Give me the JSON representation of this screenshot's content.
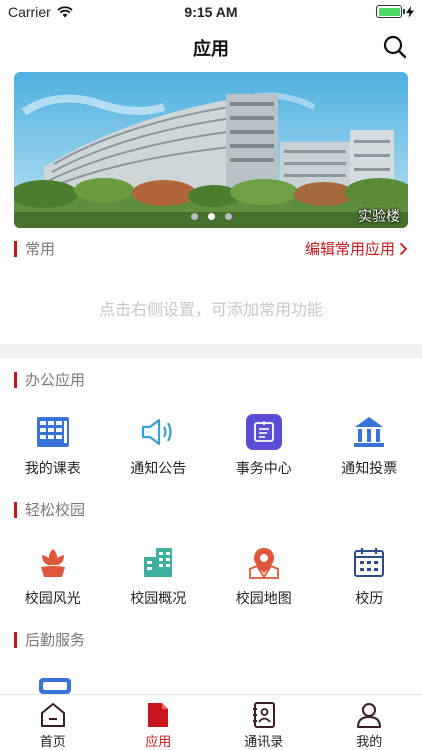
{
  "status_bar": {
    "carrier": "Carrier",
    "time": "9:15 AM",
    "battery_level": 1.0
  },
  "nav": {
    "title": "应用"
  },
  "banner": {
    "caption": "实验楼",
    "page_count": 3,
    "active_page": 2
  },
  "common": {
    "title": "常用",
    "edit_label": "编辑常用应用",
    "empty_hint": "点击右侧设置，可添加常用功能"
  },
  "sections": [
    {
      "title": "办公应用",
      "apps": [
        {
          "label": "我的课表",
          "icon": "timetable-icon"
        },
        {
          "label": "通知公告",
          "icon": "speaker-icon"
        },
        {
          "label": "事务中心",
          "icon": "affairs-icon"
        },
        {
          "label": "通知投票",
          "icon": "vote-icon"
        }
      ]
    },
    {
      "title": "轻松校园",
      "apps": [
        {
          "label": "校园风光",
          "icon": "flower-icon"
        },
        {
          "label": "校园概况",
          "icon": "building-icon"
        },
        {
          "label": "校园地图",
          "icon": "map-pin-icon"
        },
        {
          "label": "校历",
          "icon": "calendar-icon"
        }
      ]
    },
    {
      "title": "后勤服务",
      "apps": []
    }
  ],
  "tabs": [
    {
      "label": "首页",
      "icon": "home-icon"
    },
    {
      "label": "应用",
      "icon": "apps-icon",
      "active": true
    },
    {
      "label": "通讯录",
      "icon": "contacts-icon"
    },
    {
      "label": "我的",
      "icon": "user-icon"
    }
  ],
  "colors": {
    "accent": "#c8161d",
    "blue": "#3a73d8",
    "teal": "#3fb0a0",
    "orange": "#e0583c",
    "purple": "#5b4fd8",
    "navy": "#2f4a8a"
  }
}
